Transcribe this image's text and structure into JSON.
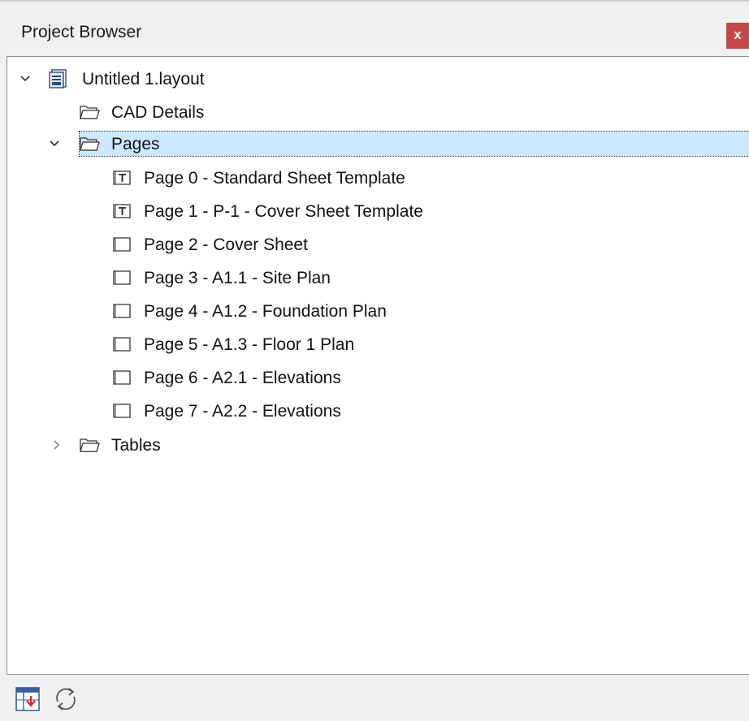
{
  "window": {
    "title": "Project Browser",
    "close_label": "x"
  },
  "tree": {
    "root": {
      "label": "Untitled 1.layout",
      "icon": "layout-file-icon",
      "expanded": true
    },
    "cad_details": {
      "label": "CAD Details",
      "icon": "folder-icon"
    },
    "pages": {
      "label": "Pages",
      "icon": "folder-icon",
      "expanded": true,
      "selected": true,
      "items": [
        {
          "label": "Page 0 - Standard Sheet Template",
          "icon": "template-page-icon"
        },
        {
          "label": "Page 1 - P-1 - Cover Sheet Template",
          "icon": "template-page-icon"
        },
        {
          "label": "Page 2 - Cover Sheet",
          "icon": "page-icon"
        },
        {
          "label": "Page 3 - A1.1 - Site Plan",
          "icon": "page-icon"
        },
        {
          "label": "Page 4 - A1.2 - Foundation Plan",
          "icon": "page-icon"
        },
        {
          "label": "Page 5 - A1.3 - Floor 1 Plan",
          "icon": "page-icon"
        },
        {
          "label": "Page 6 - A2.1 - Elevations",
          "icon": "page-icon"
        },
        {
          "label": "Page 7 - A2.2 - Elevations",
          "icon": "page-icon"
        }
      ]
    },
    "tables": {
      "label": "Tables",
      "icon": "folder-icon",
      "expanded": false
    }
  },
  "toolbar": {
    "buttons": [
      {
        "icon": "go-to-view-icon"
      },
      {
        "icon": "refresh-icon"
      }
    ]
  },
  "colors": {
    "selection": "#cce8ff",
    "close_button": "#c44747"
  }
}
